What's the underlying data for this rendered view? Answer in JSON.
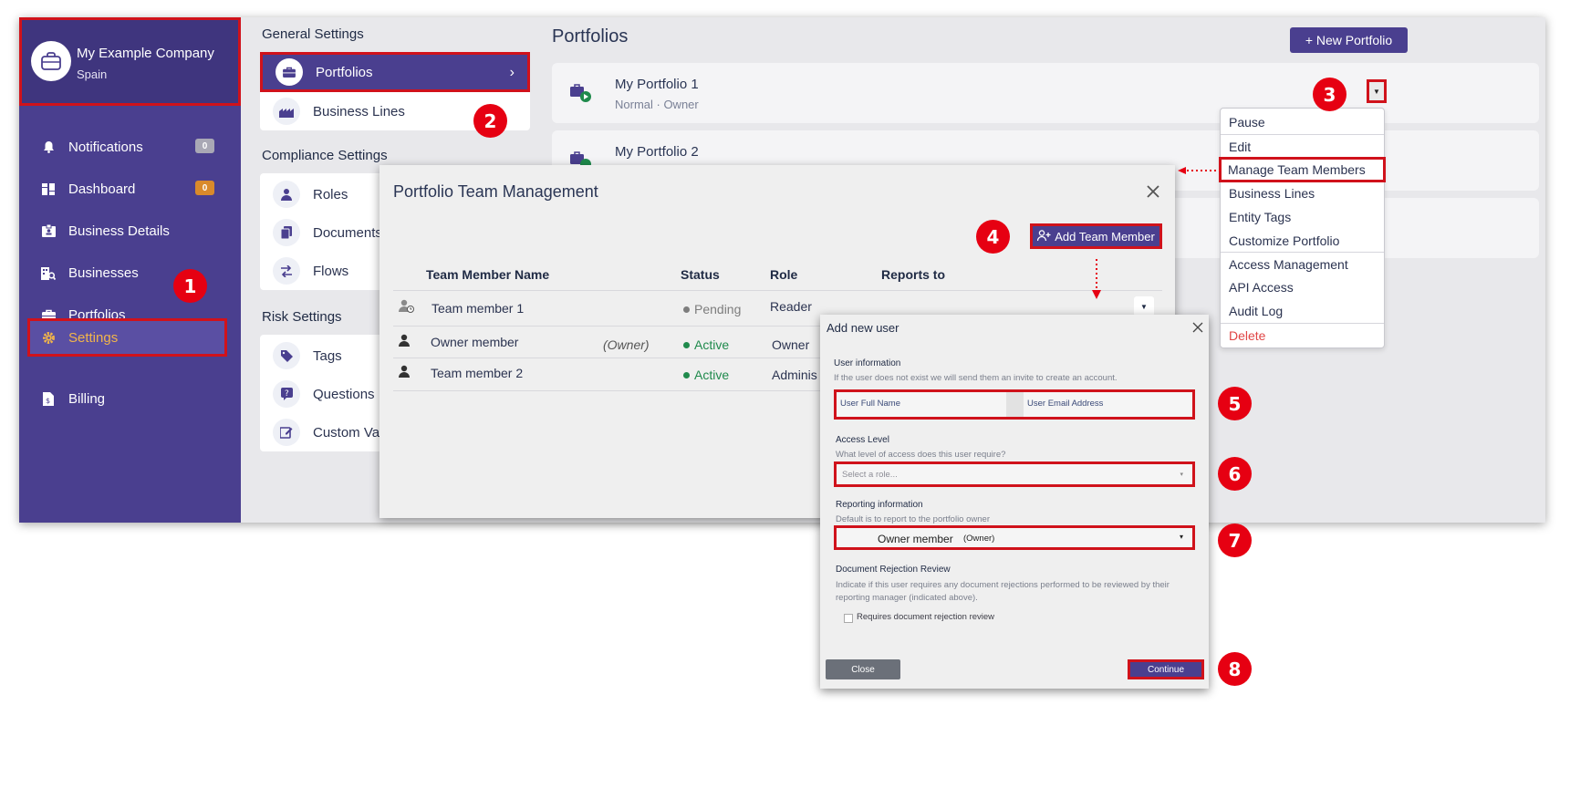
{
  "sidebar": {
    "company_name": "My Example Company",
    "company_country": "Spain",
    "items": [
      {
        "label": "Notifications",
        "icon": "bell-icon",
        "badge": "0"
      },
      {
        "label": "Dashboard",
        "icon": "dashboard-icon",
        "badge": "0"
      },
      {
        "label": "Business Details",
        "icon": "id-badge-icon"
      },
      {
        "label": "Businesses",
        "icon": "building-search-icon"
      },
      {
        "label": "Portfolios",
        "icon": "briefcase-icon"
      },
      {
        "label": "Settings",
        "icon": "gear-icon"
      },
      {
        "label": "Billing",
        "icon": "invoice-icon"
      }
    ],
    "colors": {
      "sidebar_bg": "#4a3f8f",
      "badge_gray": "#a9a8b5",
      "badge_orange": "#d98a2b",
      "active_text": "#f2b54a"
    }
  },
  "settings": {
    "general_title": "General Settings",
    "general_items": [
      {
        "label": "Portfolios",
        "icon": "briefcase-icon"
      },
      {
        "label": "Business Lines",
        "icon": "factory-icon"
      }
    ],
    "compliance_title": "Compliance Settings",
    "compliance_items": [
      {
        "label": "Roles",
        "icon": "user-role-icon"
      },
      {
        "label": "Documents",
        "icon": "documents-icon"
      },
      {
        "label": "Flows",
        "icon": "flow-icon"
      }
    ],
    "risk_title": "Risk Settings",
    "risk_items": [
      {
        "label": "Tags",
        "icon": "tag-icon"
      },
      {
        "label": "Questions",
        "icon": "question-icon"
      },
      {
        "label": "Custom Variabl",
        "icon": "edit-icon"
      }
    ]
  },
  "portfolios": {
    "title": "Portfolios",
    "new_button": "+ New Portfolio",
    "cards": [
      {
        "name": "My Portfolio 1",
        "sub": "Normal · Owner"
      },
      {
        "name": "My Portfolio 2",
        "sub": ""
      }
    ],
    "menu": [
      "Pause",
      "Edit",
      "Manage Team Members",
      "Business Lines",
      "Entity Tags",
      "Customize Portfolio",
      "Access Management",
      "API Access",
      "Audit Log",
      "Delete"
    ]
  },
  "team_modal": {
    "title": "Portfolio Team Management",
    "add_button": "Add Team Member",
    "columns": [
      "Team Member Name",
      "Status",
      "Role",
      "Reports to"
    ],
    "rows": [
      {
        "name": "Team member 1",
        "note": "",
        "status": "Pending",
        "role": "Reader"
      },
      {
        "name": "Owner member",
        "note": "(Owner)",
        "status": "Active",
        "role": "Owner"
      },
      {
        "name": "Team member 2",
        "note": "",
        "status": "Active",
        "role": "Adminis"
      }
    ]
  },
  "add_user": {
    "title": "Add new user",
    "user_info_label": "User information",
    "user_info_help": "If the user does not exist we will send them an invite to create an account.",
    "full_name_placeholder": "User Full Name",
    "email_placeholder": "User Email Address",
    "access_label": "Access Level",
    "access_help": "What level of access does this user require?",
    "role_placeholder": "Select a role...",
    "reporting_label": "Reporting information",
    "reporting_help": "Default is to report to the portfolio owner",
    "reporting_value": "Owner member",
    "reporting_note": "(Owner)",
    "rejection_label": "Document Rejection Review",
    "rejection_help": "Indicate if this user requires any document rejections performed to be reviewed by their reporting manager (indicated above).",
    "rejection_checkbox": "Requires document rejection review",
    "close_button": "Close",
    "continue_button": "Continue"
  },
  "steps": [
    "1",
    "2",
    "3",
    "4",
    "5",
    "6",
    "7",
    "8"
  ]
}
